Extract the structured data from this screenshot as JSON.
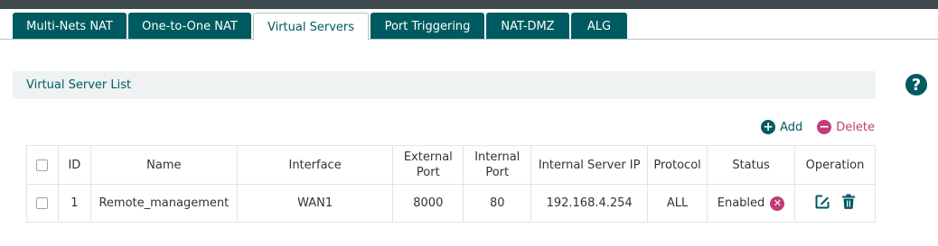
{
  "tabs": [
    {
      "label": "Multi-Nets NAT",
      "active": false
    },
    {
      "label": "One-to-One NAT",
      "active": false
    },
    {
      "label": "Virtual Servers",
      "active": true
    },
    {
      "label": "Port Triggering",
      "active": false
    },
    {
      "label": "NAT-DMZ",
      "active": false
    },
    {
      "label": "ALG",
      "active": false
    }
  ],
  "section": {
    "title": "Virtual Server List"
  },
  "help": {
    "icon": "help-icon",
    "glyph": "?"
  },
  "actions": {
    "add_label": "Add",
    "delete_label": "Delete",
    "add_glyph": "+",
    "delete_glyph": "−"
  },
  "table": {
    "headers": {
      "id": "ID",
      "name": "Name",
      "interface": "Interface",
      "external_port_line1": "External",
      "external_port_line2": "Port",
      "internal_port_line1": "Internal",
      "internal_port_line2": "Port",
      "internal_server_ip": "Internal Server IP",
      "protocol": "Protocol",
      "status": "Status",
      "operation": "Operation"
    },
    "rows": [
      {
        "id": "1",
        "name": "Remote_management",
        "interface": "WAN1",
        "external_port": "8000",
        "internal_port": "80",
        "internal_server_ip": "192.168.4.254",
        "protocol": "ALL",
        "status": "Enabled",
        "status_toggle_glyph": "✕"
      }
    ]
  },
  "colors": {
    "brand": "#005a61",
    "topbar": "#3f4a4f",
    "accent_delete": "#c23d78",
    "section_bg": "#eef2f3"
  }
}
